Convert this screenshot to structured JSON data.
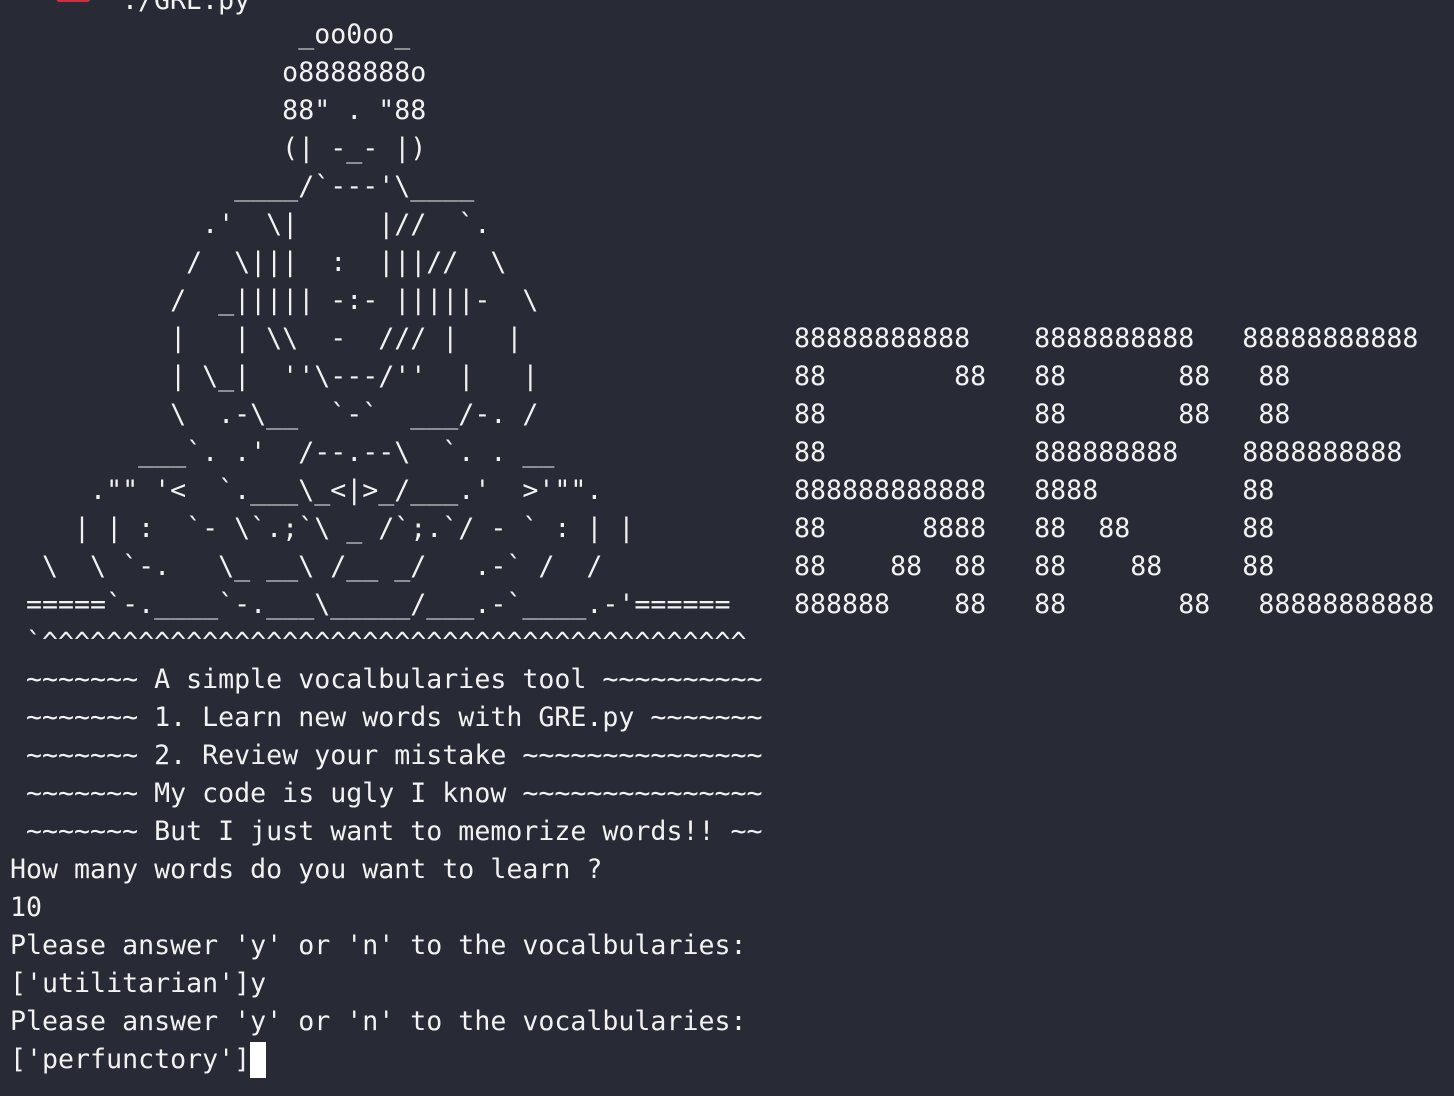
{
  "command": {
    "icon": "ruby-gem-icon",
    "text": "./GRE.py"
  },
  "ascii_art": {
    "buddha": [
      "                  _oo0oo_",
      "                 o8888888o",
      "                 88\" . \"88",
      "                 (| -_- |)",
      "              ____/`---'\\____",
      "            .'  \\|     |//  `.",
      "           /  \\|||  :  |||//  \\",
      "          /  _||||| -:- |||||-  \\",
      "          |   | \\\\  -  /// |   |",
      "          | \\_|  ''\\---/''  |   |",
      "          \\  .-\\__  `-`  ___/-. /",
      "        ___`. .'  /--.--\\  `. . __",
      "     .\"\" '<  `.___\\_<|>_/___.'  >'\"\".",
      "    | | :  `- \\`.;`\\ _ /`;.`/ - ` : | |",
      "  \\  \\ `-.   \\_ __\\ /__ _/   .-` /  /",
      " =====`-.____`-.___\\_____/___.-`____.-'======",
      " `^^^^^^^^^^^^^^^^^^^^^^^^^^^^^^^^^^^^^^^^^^^^"
    ],
    "gre_banner": [
      "88888888888    8888888888   88888888888",
      "88        88   88       88   88",
      "88             88       88   88",
      "88             888888888    8888888888",
      "888888888888   8888         88",
      "88      8888   88  88       88",
      "88    88  88   88    88     88",
      "888888    88   88       88   88888888888"
    ]
  },
  "output": {
    "menu": [
      " ~~~~~~~ A simple vocalbularies tool ~~~~~~~~~~",
      " ~~~~~~~ 1. Learn new words with GRE.py ~~~~~~~",
      " ~~~~~~~ 2. Review your mistake ~~~~~~~~~~~~~~~",
      " ~~~~~~~ My code is ugly I know ~~~~~~~~~~~~~~~",
      " ~~~~~~~ But I just want to memorize words!! ~~"
    ],
    "prompt_count": "How many words do you want to learn ?",
    "answer_count": "10",
    "prompt_1": "Please answer 'y' or 'n' to the vocalbularies:",
    "word_1": "['utilitarian']y",
    "prompt_2": "Please answer 'y' or 'n' to the vocalbularies:",
    "word_2": "['perfunctory']"
  },
  "colors": {
    "background": "#282a36",
    "foreground": "#f2f2f2",
    "cursor": "#ffffff",
    "icon": "#e0263a"
  }
}
